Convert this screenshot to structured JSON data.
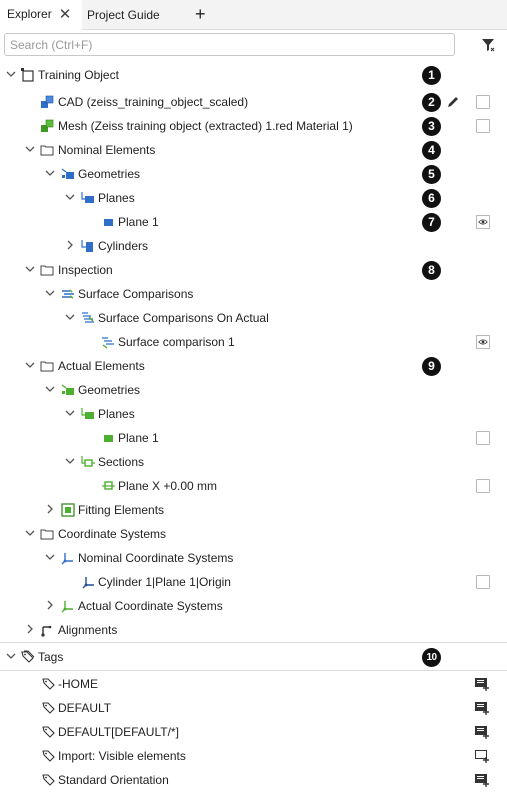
{
  "tabs": {
    "explorer": "Explorer",
    "project_guide": "Project Guide",
    "close_glyph": "✕",
    "add_glyph": "+"
  },
  "search": {
    "placeholder": "Search (Ctrl+F)"
  },
  "tree": {
    "root": "Training Object",
    "cad": "CAD (zeiss_training_object_scaled)",
    "mesh": "Mesh (Zeiss training object (extracted) 1.red Material 1)",
    "nominal_elements": "Nominal Elements",
    "nominal_geometries": "Geometries",
    "nominal_planes": "Planes",
    "nominal_plane1": "Plane 1",
    "cylinders": "Cylinders",
    "inspection": "Inspection",
    "surface_comparisons": "Surface Comparisons",
    "surface_comparisons_on_actual": "Surface Comparisons On Actual",
    "surface_comparison1": "Surface comparison 1",
    "actual_elements": "Actual Elements",
    "actual_geometries": "Geometries",
    "actual_planes": "Planes",
    "actual_plane1": "Plane 1",
    "sections": "Sections",
    "plane_x": "Plane X +0.00 mm",
    "fitting_elements": "Fitting Elements",
    "coordinate_systems": "Coordinate Systems",
    "nominal_coordinate_systems": "Nominal Coordinate Systems",
    "cylinder_origin": "Cylinder 1|Plane 1|Origin",
    "actual_coordinate_systems": "Actual Coordinate Systems",
    "alignments": "Alignments"
  },
  "tags": {
    "header": "Tags",
    "items": [
      "-HOME",
      "DEFAULT",
      "DEFAULT[DEFAULT/*]",
      "Import: Visible elements",
      "Standard Orientation"
    ]
  },
  "badges": [
    "1",
    "2",
    "3",
    "4",
    "5",
    "6",
    "7",
    "8",
    "9",
    "10"
  ],
  "colors": {
    "nominal_blue": "#2f6fc9",
    "actual_green": "#4caf2f",
    "badge": "#111111",
    "tab_bar": "#f3f3f3"
  }
}
